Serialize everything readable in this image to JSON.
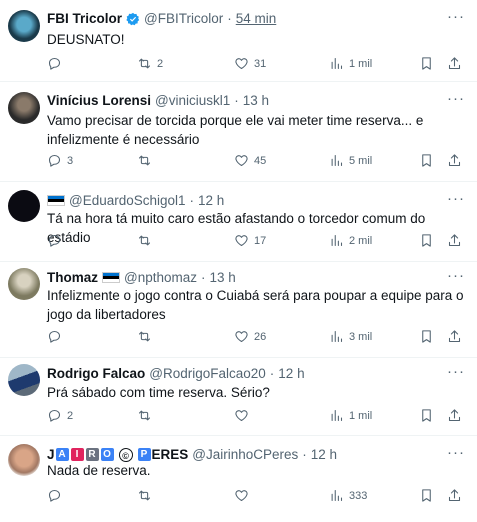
{
  "tweets": [
    {
      "name": "FBI Tricolor",
      "handle": "@FBITricolor",
      "time": "54 min",
      "text": "DEUSNATO!",
      "replies": "",
      "retweets": "2",
      "likes": "31",
      "views": "1 mil"
    },
    {
      "name": "Vinícius Lorensi",
      "handle": "@viniciuskl1",
      "time": "13 h",
      "text": "Vamo precisar de torcida porque ele vai meter time reserva... e infelizmente é necessário",
      "replies": "3",
      "retweets": "",
      "likes": "45",
      "views": "5 mil"
    },
    {
      "name": "",
      "handle": "@EduardoSchigol1",
      "time": "12 h",
      "text": "Tá na hora tá muito caro estão afastando o torcedor comum do estádio",
      "replies": "",
      "retweets": "",
      "likes": "17",
      "views": "2 mil"
    },
    {
      "name": "Thomaz",
      "handle": "@npthomaz",
      "time": "13 h",
      "text": "Infelizmente o jogo contra o Cuiabá será para poupar a equipe para o jogo da libertadores",
      "replies": "",
      "retweets": "",
      "likes": "26",
      "views": "3 mil"
    },
    {
      "name": "Rodrigo Falcao",
      "handle": "@RodrigoFalcao20",
      "time": "12 h",
      "text": "Prá sábado com time reserva. Sério?",
      "replies": "2",
      "retweets": "",
      "likes": "",
      "views": "1 mil"
    },
    {
      "name_parts": [
        "J",
        "A",
        "I",
        "R",
        "O",
        "©",
        "P",
        "ERES"
      ],
      "handle": "@JairinhoCPeres",
      "time": "12 h",
      "text": "Nada de reserva.",
      "replies": "",
      "retweets": "",
      "likes": "",
      "views": "333"
    }
  ],
  "colors": {
    "text": "#0f1419",
    "muted": "#536471",
    "verified": "#1d9bf0",
    "divider": "#eff3f4"
  },
  "icons": [
    "reply-icon",
    "retweet-icon",
    "like-icon",
    "views-icon",
    "bookmark-icon",
    "share-icon",
    "more-icon",
    "verified-icon"
  ]
}
